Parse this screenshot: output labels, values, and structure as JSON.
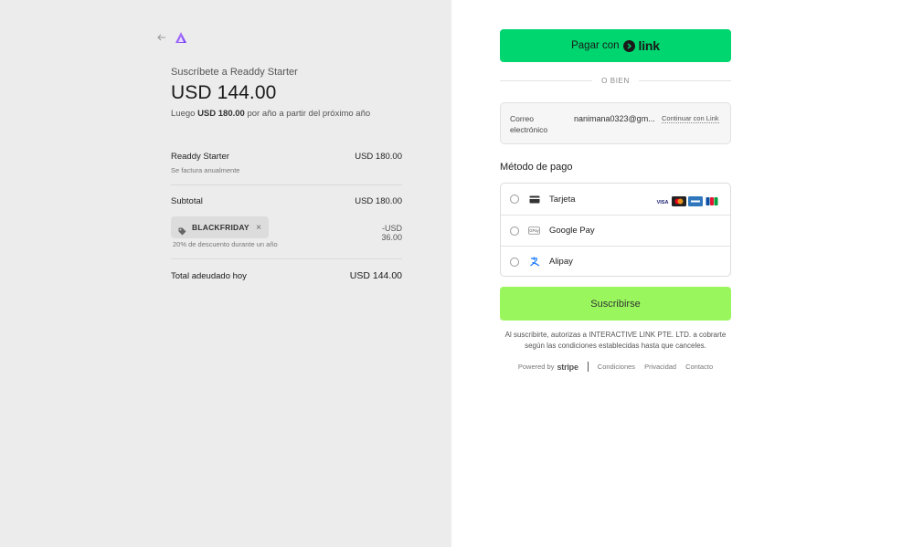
{
  "summary": {
    "subscribe_label": "Suscríbete a Readdy Starter",
    "price": "USD 144.00",
    "then_prefix": "Luego",
    "then_amount": "USD 180.00",
    "then_suffix": "por año a partir del próximo año",
    "item": {
      "name": "Readdy Starter",
      "billing": "Se factura anualmente",
      "price": "USD 180.00"
    },
    "subtotal": {
      "label": "Subtotal",
      "value": "USD 180.00"
    },
    "coupon": {
      "code": "BLACKFRIDAY",
      "remove": "×",
      "discount": "-USD 36.00",
      "note": "20% de descuento durante un año"
    },
    "total": {
      "label": "Total adeudado hoy",
      "value": "USD 144.00"
    }
  },
  "checkout": {
    "link_button": {
      "prefix": "Pagar con",
      "brand": "link"
    },
    "or_label": "O BIEN",
    "email": {
      "label": "Correo electrónico",
      "value": "nanimana0323@gm...",
      "link": "Continuar con Link"
    },
    "payment_title": "Método de pago",
    "methods": [
      {
        "label": "Tarjeta",
        "icon": "credit-card-icon"
      },
      {
        "label": "Google Pay",
        "icon": "google-pay-icon"
      },
      {
        "label": "Alipay",
        "icon": "alipay-icon"
      }
    ],
    "subscribe_button": "Suscribirse",
    "legal": "Al suscribirte, autorizas a INTERACTIVE LINK PTE. LTD. a cobrarte según las condiciones establecidas hasta que canceles.",
    "footer": {
      "powered_by": "Powered by",
      "brand": "stripe",
      "links": [
        "Condiciones",
        "Privacidad",
        "Contacto"
      ]
    }
  },
  "colors": {
    "left_bg": "#ececec",
    "link_green": "#00d66f",
    "subscribe_green": "#99f75d"
  }
}
